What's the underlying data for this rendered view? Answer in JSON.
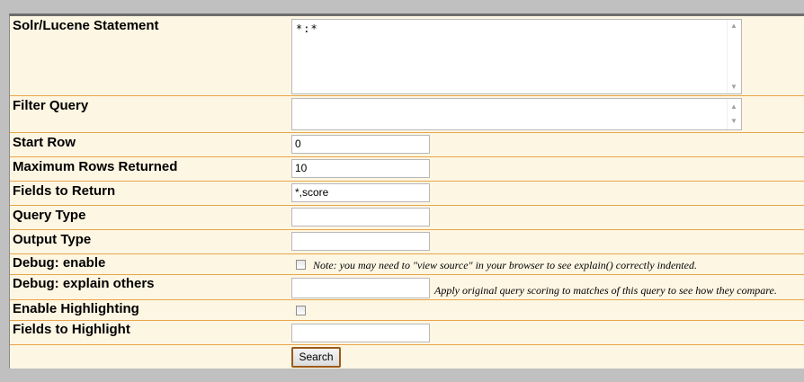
{
  "form": {
    "statement": {
      "label": "Solr/Lucene Statement",
      "value": "*:*"
    },
    "filter_query": {
      "label": "Filter Query",
      "value": ""
    },
    "start_row": {
      "label": "Start Row",
      "value": "0"
    },
    "max_rows": {
      "label": "Maximum Rows Returned",
      "value": "10"
    },
    "fields": {
      "label": "Fields to Return",
      "value": "*,score"
    },
    "query_type": {
      "label": "Query Type",
      "value": ""
    },
    "output_type": {
      "label": "Output Type",
      "value": ""
    },
    "debug_enable": {
      "label": "Debug: enable",
      "checked": false,
      "note": "Note: you may need to \"view source\" in your browser to see explain() correctly indented."
    },
    "debug_explain": {
      "label": "Debug: explain others",
      "value": "",
      "note": "Apply original query scoring to matches of this query to see how they compare."
    },
    "highlighting": {
      "label": "Enable Highlighting",
      "checked": false
    },
    "fields_highlight": {
      "label": "Fields to Highlight",
      "value": ""
    },
    "search_button": "Search"
  },
  "scroll_icons": {
    "up": "scroll-up-arrow",
    "down": "scroll-down-arrow"
  },
  "colors": {
    "row_bg": "#fdf6e3",
    "row_border": "#e8a64a",
    "button_border": "#9b5a1a"
  }
}
